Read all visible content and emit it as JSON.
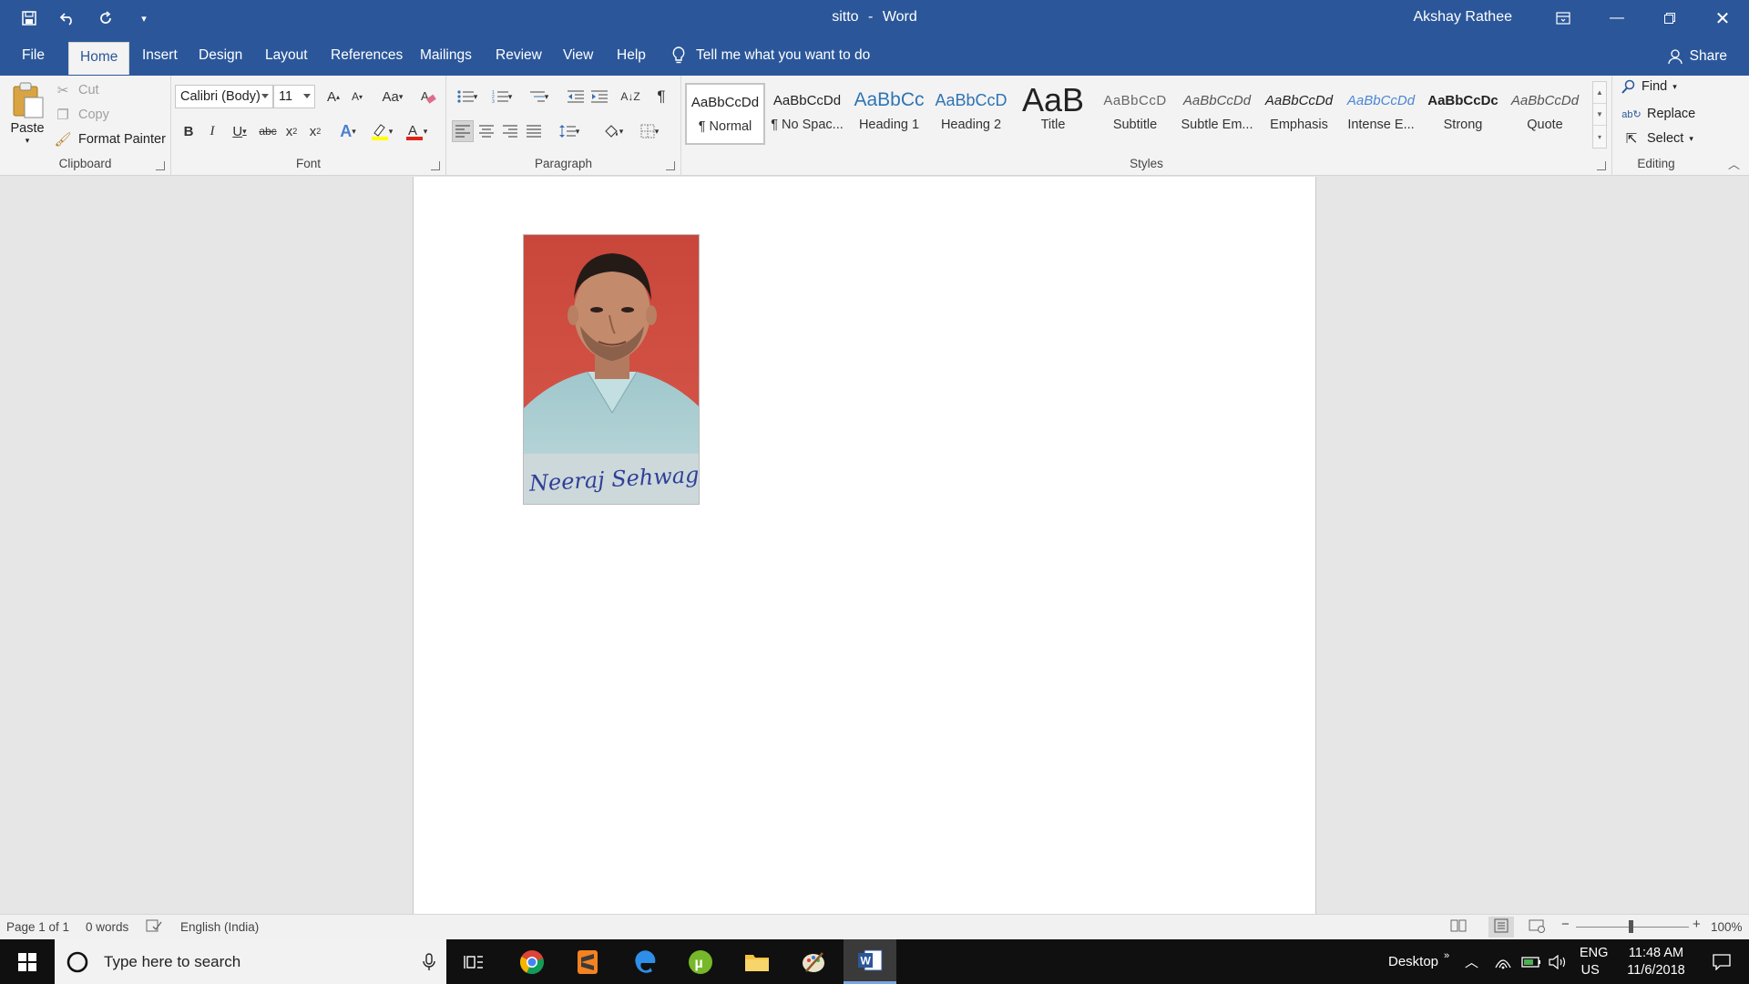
{
  "window": {
    "doc_name": "sitto",
    "separator": "-",
    "app_name": "Word",
    "user": "Akshay Rathee"
  },
  "tabs": {
    "file": "File",
    "home": "Home",
    "insert": "Insert",
    "design": "Design",
    "layout": "Layout",
    "references": "References",
    "mailings": "Mailings",
    "review": "Review",
    "view": "View",
    "help": "Help",
    "tell_me": "Tell me what you want to do",
    "share": "Share"
  },
  "clipboard": {
    "paste": "Paste",
    "cut": "Cut",
    "copy": "Copy",
    "format_painter": "Format Painter",
    "label": "Clipboard"
  },
  "font": {
    "family": "Calibri (Body)",
    "size": "11",
    "label": "Font",
    "change_case": "Aa",
    "grow": "A",
    "shrink": "A",
    "bold": "B",
    "italic": "I",
    "underline": "U",
    "strike": "abc",
    "subscript": "x",
    "subscript_mark": "2",
    "superscript": "x",
    "superscript_mark": "2"
  },
  "paragraph": {
    "label": "Paragraph"
  },
  "styles": {
    "label": "Styles",
    "items": [
      {
        "preview": "AaBbCcDd",
        "name": "¶ Normal"
      },
      {
        "preview": "AaBbCcDd",
        "name": "¶ No Spac..."
      },
      {
        "preview": "AaBbCc",
        "name": "Heading 1"
      },
      {
        "preview": "AaBbCcD",
        "name": "Heading 2"
      },
      {
        "preview": "AaB",
        "name": "Title"
      },
      {
        "preview": "AaBbCcD",
        "name": "Subtitle"
      },
      {
        "preview": "AaBbCcDd",
        "name": "Subtle Em..."
      },
      {
        "preview": "AaBbCcDd",
        "name": "Emphasis"
      },
      {
        "preview": "AaBbCcDd",
        "name": "Intense E..."
      },
      {
        "preview": "AaBbCcDc",
        "name": "Strong"
      },
      {
        "preview": "AaBbCcDd",
        "name": "Quote"
      }
    ]
  },
  "editing": {
    "find": "Find",
    "replace": "Replace",
    "select": "Select",
    "label": "Editing"
  },
  "document": {
    "signature_text": "Neeraj Sehwag"
  },
  "status": {
    "page": "Page 1 of 1",
    "words": "0 words",
    "language": "English (India)",
    "zoom": "100%"
  },
  "taskbar": {
    "search_placeholder": "Type here to search",
    "desktop": "Desktop",
    "lang_top": "ENG",
    "lang_bottom": "US",
    "time": "11:48 AM",
    "date": "11/6/2018"
  }
}
